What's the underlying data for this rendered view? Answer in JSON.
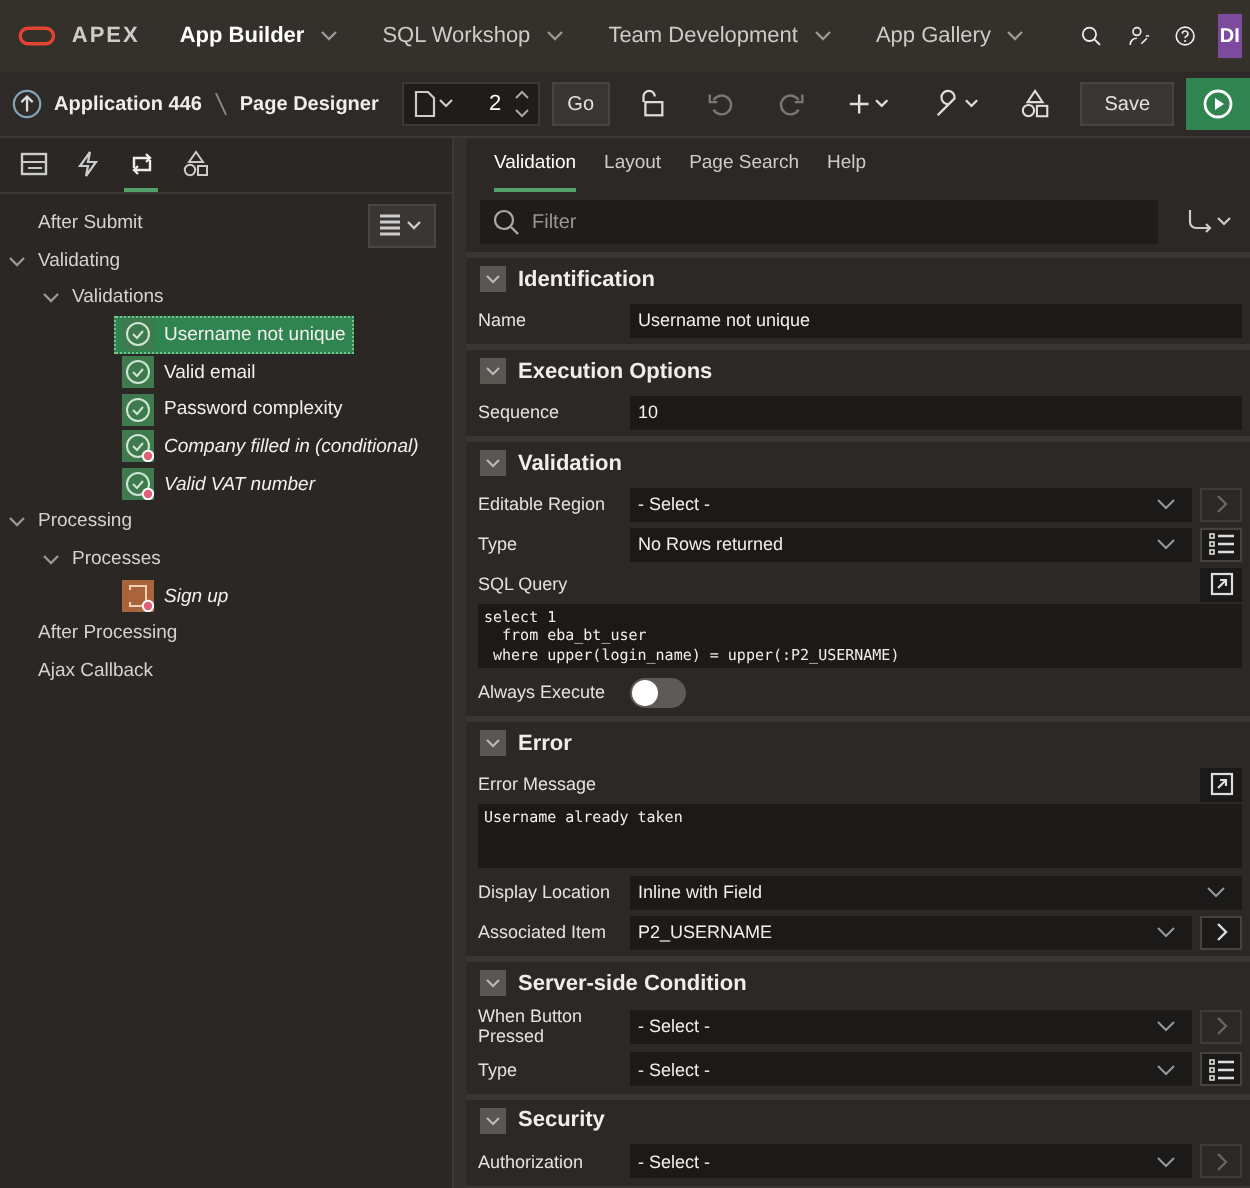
{
  "topnav": {
    "brand": "APEX",
    "menus": [
      {
        "label": "App Builder",
        "selected": true
      },
      {
        "label": "SQL Workshop",
        "selected": false
      },
      {
        "label": "Team Development",
        "selected": false
      },
      {
        "label": "App Gallery",
        "selected": false
      }
    ],
    "avatar": "DI"
  },
  "toolbar": {
    "breadcrumb": [
      "Application 446",
      "Page Designer"
    ],
    "page_number": "2",
    "go": "Go",
    "save": "Save"
  },
  "left_tabs": [
    {
      "kind": "rendering",
      "selected": false
    },
    {
      "kind": "dynamic",
      "selected": false
    },
    {
      "kind": "processing",
      "selected": true
    },
    {
      "kind": "shared",
      "selected": false
    }
  ],
  "tree": [
    {
      "label": "After Submit",
      "kind": "group"
    },
    {
      "label": "Validating",
      "kind": "group",
      "expanded": true,
      "children": [
        {
          "label": "Validations",
          "kind": "group",
          "expanded": true,
          "children": [
            {
              "label": "Username not unique",
              "kind": "validation",
              "conditional": false,
              "selected": true
            },
            {
              "label": "Valid email",
              "kind": "validation",
              "conditional": false,
              "selected": false
            },
            {
              "label": "Password complexity",
              "kind": "validation",
              "conditional": false,
              "selected": false
            },
            {
              "label": "Company filled in (conditional)",
              "kind": "validation",
              "conditional": true,
              "selected": false
            },
            {
              "label": "Valid VAT number",
              "kind": "validation",
              "conditional": true,
              "selected": false
            }
          ]
        }
      ]
    },
    {
      "label": "Processing",
      "kind": "group",
      "expanded": true,
      "children": [
        {
          "label": "Processes",
          "kind": "group",
          "expanded": true,
          "children": [
            {
              "label": "Sign up",
              "kind": "process",
              "conditional": true,
              "selected": false
            }
          ]
        }
      ]
    },
    {
      "label": "After Processing",
      "kind": "group"
    },
    {
      "label": "Ajax Callback",
      "kind": "group"
    }
  ],
  "properties": {
    "tabs": [
      {
        "label": "Validation",
        "selected": true
      },
      {
        "label": "Layout",
        "selected": false
      },
      {
        "label": "Page Search",
        "selected": false
      },
      {
        "label": "Help",
        "selected": false
      }
    ],
    "filter": {
      "placeholder": "Filter"
    },
    "sections": [
      {
        "title": "Identification",
        "expanded": true,
        "rows": [
          {
            "kind": "text",
            "label": "Name",
            "value": "Username not unique"
          }
        ]
      },
      {
        "title": "Execution Options",
        "expanded": true,
        "rows": [
          {
            "kind": "text",
            "label": "Sequence",
            "value": "10"
          }
        ]
      },
      {
        "title": "Validation",
        "expanded": true,
        "rows": [
          {
            "kind": "select",
            "label": "Editable Region",
            "value": "- Select -",
            "side": {
              "kind": "go",
              "disabled": true
            }
          },
          {
            "kind": "select",
            "label": "Type",
            "value": "No Rows returned",
            "side": {
              "kind": "list",
              "disabled": false
            }
          },
          {
            "kind": "code",
            "label": "SQL Query",
            "value": "select 1\n  from eba_bt_user\n where upper(login_name) = upper(:P2_USERNAME)"
          },
          {
            "kind": "switch",
            "label": "Always Execute",
            "on": false
          }
        ]
      },
      {
        "title": "Error",
        "expanded": true,
        "rows": [
          {
            "kind": "code",
            "label": "Error Message",
            "value": "Username already taken"
          },
          {
            "kind": "select",
            "label": "Display Location",
            "value": "Inline with Field"
          },
          {
            "kind": "select",
            "label": "Associated Item",
            "value": "P2_USERNAME",
            "side": {
              "kind": "go",
              "disabled": false
            }
          }
        ]
      },
      {
        "title": "Server-side Condition",
        "expanded": true,
        "rows": [
          {
            "kind": "select",
            "label": "When Button Pressed",
            "value": "- Select -",
            "side": {
              "kind": "go",
              "disabled": true
            }
          },
          {
            "kind": "select",
            "label": "Type",
            "value": "- Select -",
            "side": {
              "kind": "list",
              "disabled": false
            }
          }
        ]
      },
      {
        "title": "Security",
        "expanded": true,
        "rows": [
          {
            "kind": "select",
            "label": "Authorization",
            "value": "- Select -",
            "side": {
              "kind": "go",
              "disabled": true
            }
          }
        ]
      }
    ]
  }
}
